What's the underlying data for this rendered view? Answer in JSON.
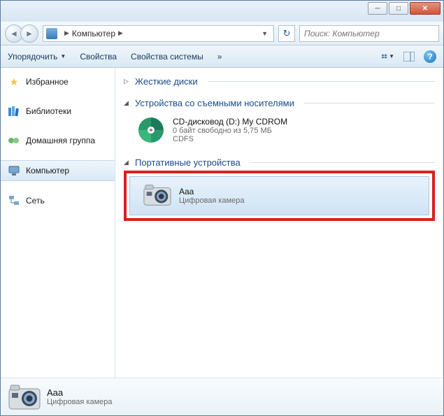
{
  "breadcrumb": {
    "location": "Компьютер"
  },
  "search": {
    "placeholder": "Поиск: Компьютер"
  },
  "toolbar": {
    "organize": "Упорядочить",
    "properties": "Свойства",
    "system_properties": "Свойства системы",
    "more": "»"
  },
  "sidebar": {
    "favorites": "Избранное",
    "libraries": "Библиотеки",
    "homegroup": "Домашняя группа",
    "computer": "Компьютер",
    "network": "Сеть"
  },
  "sections": {
    "hard_disks": "Жесткие диски",
    "removable": "Устройства со съемными носителями",
    "portable": "Портативные устройства"
  },
  "cd_drive": {
    "title": "CD-дисковод (D:) My CDROM",
    "free": "0 байт свободно из 5,75 МБ",
    "fs": "CDFS"
  },
  "camera": {
    "title": "Aaa",
    "subtitle": "Цифровая камера"
  },
  "details": {
    "title": "Aaa",
    "subtitle": "Цифровая камера"
  }
}
